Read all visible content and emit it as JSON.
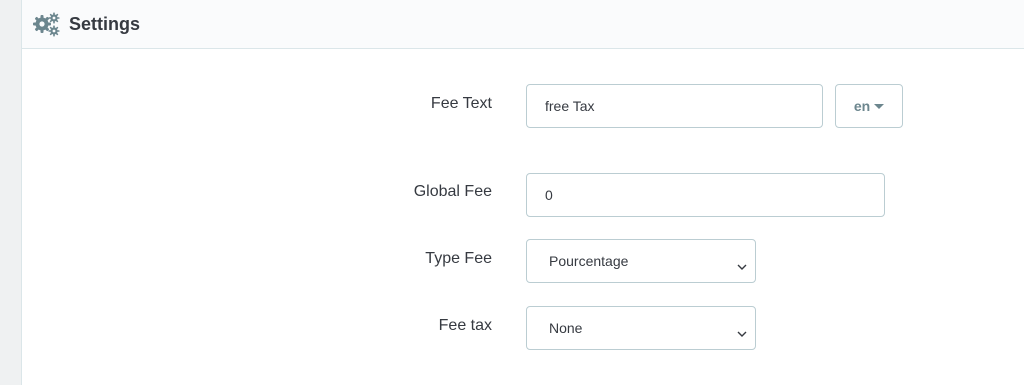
{
  "header": {
    "title": "Settings",
    "icon": "cogs-icon"
  },
  "form": {
    "fee_text": {
      "label": "Fee Text",
      "value": "free Tax",
      "language": "en"
    },
    "global_fee": {
      "label": "Global Fee",
      "value": "0"
    },
    "type_fee": {
      "label": "Type Fee",
      "selected": "Pourcentage"
    },
    "fee_tax": {
      "label": "Fee tax",
      "selected": "None"
    }
  },
  "colors": {
    "text": "#363a41",
    "border": "#bbcdd2",
    "header_bg": "#fafbfc",
    "muted": "#6c868e"
  }
}
